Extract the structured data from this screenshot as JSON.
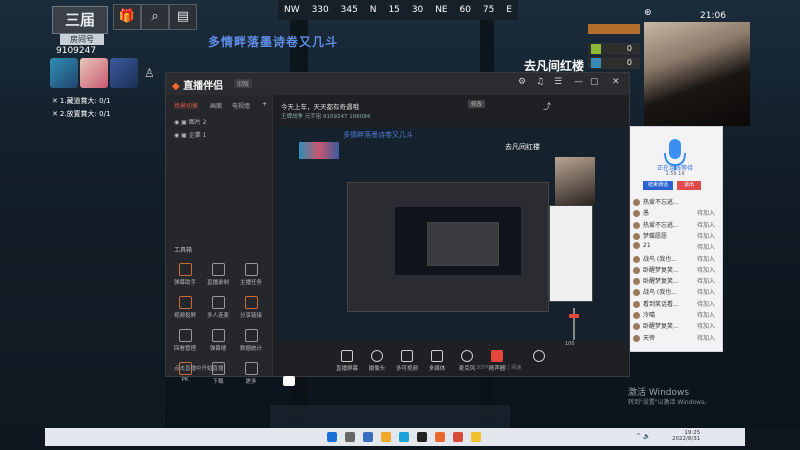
{
  "hud": {
    "logo": "三届",
    "room_label": "房间号",
    "room_number": "9109247",
    "tasks": [
      "1.藏道賞大: 0/1",
      "2.放置賞大: 0/1"
    ]
  },
  "compass": [
    "NW",
    "330",
    "345",
    "N",
    "15",
    "30",
    "NE",
    "60",
    "75",
    "E"
  ],
  "overlay": {
    "poem_title": "多情畔落墨诗卷又几斗",
    "room_title": "去凡间红楼"
  },
  "stats": {
    "row1": "",
    "row2": "0",
    "row3": "0"
  },
  "system": {
    "clock": "21:06"
  },
  "voice_panel": {
    "status": "正在连线等待",
    "sub": "1.58.19",
    "accept": "结束通话",
    "reject": "退出",
    "users": [
      {
        "name": "热爱不忘逃...",
        "state": ""
      },
      {
        "name": "愚",
        "state": "待加入"
      },
      {
        "name": "热爱不忘逃...",
        "state": "待加入"
      },
      {
        "name": "梦蝶愿愿",
        "state": "待加入"
      },
      {
        "name": "21",
        "state": "待加入"
      },
      {
        "name": "战鸟 (我也...",
        "state": "待加入"
      },
      {
        "name": "卧醒梦复笑...",
        "state": "待加入"
      },
      {
        "name": "卧醒梦复笑...",
        "state": "待加入"
      },
      {
        "name": "战鸟 (我也...",
        "state": "待加入"
      },
      {
        "name": "看到笑话看...",
        "state": "待加入"
      },
      {
        "name": "冷噶",
        "state": "待加入"
      },
      {
        "name": "卧醒梦复笑...",
        "state": "待加入"
      },
      {
        "name": "天帝",
        "state": "待加入"
      }
    ]
  },
  "app": {
    "name": "直播伴侣",
    "version": "旧版",
    "side_tabs": [
      "场景切换",
      "画面",
      "电视墙"
    ],
    "scenes": [
      "图片 2",
      "企業 1"
    ],
    "tools_label": "工具箱",
    "tools": [
      {
        "label": "弹幕助手",
        "hl": true
      },
      {
        "label": "直播录制",
        "hl": false
      },
      {
        "label": "主播任务",
        "hl": false
      },
      {
        "label": "视频投屏",
        "hl": true
      },
      {
        "label": "多人连麦",
        "hl": false
      },
      {
        "label": "分享链接",
        "hl": true
      },
      {
        "label": "回看管理",
        "hl": false
      },
      {
        "label": "弹幕墙",
        "hl": false
      },
      {
        "label": "数据统计",
        "hl": false
      },
      {
        "label": "PK",
        "hl": true
      },
      {
        "label": "下载",
        "hl": false
      },
      {
        "label": "更多",
        "hl": false
      }
    ],
    "announcement": "今天上车，天天都有奇遇哦",
    "announce_badge": "修改",
    "meta": "王牌战争  元宇宙  9109247  106084",
    "controls": [
      "直播屏幕",
      "摄像头",
      "多可视频",
      "多媒体",
      "麦克风",
      "扬声器"
    ],
    "footer_left": "点击直播中开始直播",
    "footer_right": "30FPS  |  CPU  |  网速",
    "slider_value": "100"
  },
  "activate": {
    "line1": "激活 Windows",
    "line2": "转到\"设置\"以激活 Windows。"
  },
  "taskbar": {
    "time": "19:25",
    "date": "2022/8/31"
  }
}
